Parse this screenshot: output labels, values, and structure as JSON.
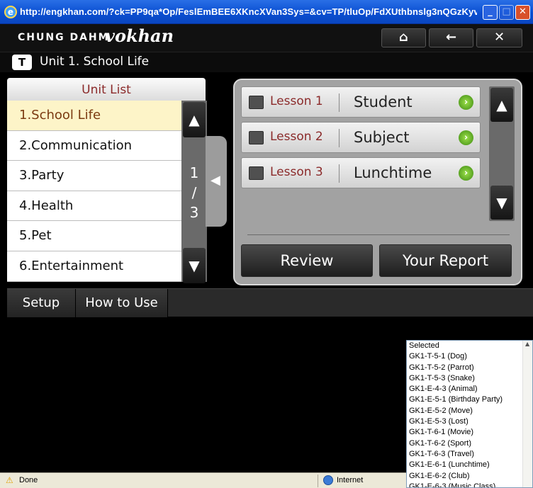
{
  "browser": {
    "url": "http://engkhan.com/?ck=PP9qa*Op/FeslEmBEE6XKncXVan3Sys=&cv=TP/tluOp/FdXUthbnslg3nQGzKyv...",
    "status_text": "Done",
    "zone_text": "Internet"
  },
  "header": {
    "brand_text": "CHUNG DAHM",
    "brand_script": "vokhan",
    "unit_badge": "T",
    "unit_title": "Unit 1. School Life"
  },
  "unit_list": {
    "heading": "Unit List",
    "items": [
      "1.School Life",
      "2.Communication",
      "3.Party",
      "4.Health",
      "5.Pet",
      "6.Entertainment"
    ],
    "selected_index": 0,
    "page_current": "1",
    "page_sep": "/",
    "page_total": "3"
  },
  "lessons": [
    {
      "number": "Lesson 1",
      "name": "Student"
    },
    {
      "number": "Lesson 2",
      "name": "Subject"
    },
    {
      "number": "Lesson 3",
      "name": "Lunchtime"
    }
  ],
  "actions": {
    "review": "Review",
    "report": "Your Report"
  },
  "toolbar": {
    "setup": "Setup",
    "how_to_use": "How to Use"
  },
  "dropdown": {
    "items": [
      "Selected",
      "GK1-T-5-1 (Dog)",
      "GK1-T-5-2 (Parrot)",
      "GK1-T-5-3 (Snake)",
      "GK1-E-4-3 (Animal)",
      "GK1-E-5-1 (Birthday Party)",
      "GK1-E-5-2 (Move)",
      "GK1-E-5-3 (Lost)",
      "GK1-T-6-1 (Movie)",
      "GK1-T-6-2 (Sport)",
      "GK1-T-6-3 (Travel)",
      "GK1-E-6-1 (Lunchtime)",
      "GK1-E-6-2 (Club)",
      "GK1-E-6-3 (Music Class)"
    ]
  }
}
